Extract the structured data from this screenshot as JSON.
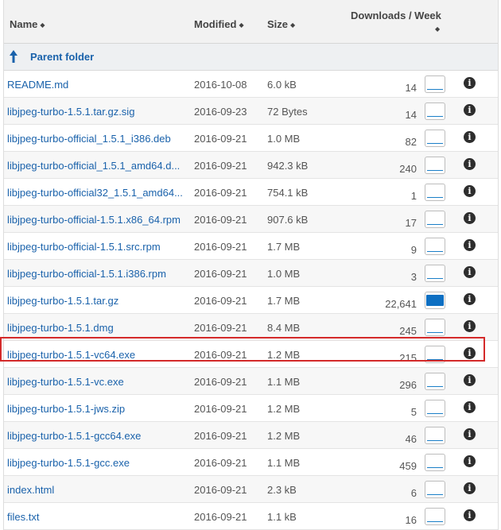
{
  "header": {
    "name": "Name",
    "modified": "Modified",
    "size": "Size",
    "downloads": "Downloads / Week",
    "sort_glyph": "◆"
  },
  "parent": {
    "label": "Parent folder"
  },
  "info_glyph": "i",
  "rows": [
    {
      "name": "README.md",
      "modified": "2016-10-08",
      "size": "6.0 kB",
      "downloads": "14"
    },
    {
      "name": "libjpeg-turbo-1.5.1.tar.gz.sig",
      "modified": "2016-09-23",
      "size": "72 Bytes",
      "downloads": "14"
    },
    {
      "name": "libjpeg-turbo-official_1.5.1_i386.deb",
      "modified": "2016-09-21",
      "size": "1.0 MB",
      "downloads": "82"
    },
    {
      "name": "libjpeg-turbo-official_1.5.1_amd64.d...",
      "modified": "2016-09-21",
      "size": "942.3 kB",
      "downloads": "240"
    },
    {
      "name": "libjpeg-turbo-official32_1.5.1_amd64...",
      "modified": "2016-09-21",
      "size": "754.1 kB",
      "downloads": "1"
    },
    {
      "name": "libjpeg-turbo-official-1.5.1.x86_64.rpm",
      "modified": "2016-09-21",
      "size": "907.6 kB",
      "downloads": "17"
    },
    {
      "name": "libjpeg-turbo-official-1.5.1.src.rpm",
      "modified": "2016-09-21",
      "size": "1.7 MB",
      "downloads": "9"
    },
    {
      "name": "libjpeg-turbo-official-1.5.1.i386.rpm",
      "modified": "2016-09-21",
      "size": "1.0 MB",
      "downloads": "3"
    },
    {
      "name": "libjpeg-turbo-1.5.1.tar.gz",
      "modified": "2016-09-21",
      "size": "1.7 MB",
      "downloads": "22,641"
    },
    {
      "name": "libjpeg-turbo-1.5.1.dmg",
      "modified": "2016-09-21",
      "size": "8.4 MB",
      "downloads": "245"
    },
    {
      "name": "libjpeg-turbo-1.5.1-vc64.exe",
      "modified": "2016-09-21",
      "size": "1.2 MB",
      "downloads": "215"
    },
    {
      "name": "libjpeg-turbo-1.5.1-vc.exe",
      "modified": "2016-09-21",
      "size": "1.1 MB",
      "downloads": "296"
    },
    {
      "name": "libjpeg-turbo-1.5.1-jws.zip",
      "modified": "2016-09-21",
      "size": "1.2 MB",
      "downloads": "5"
    },
    {
      "name": "libjpeg-turbo-1.5.1-gcc64.exe",
      "modified": "2016-09-21",
      "size": "1.2 MB",
      "downloads": "46"
    },
    {
      "name": "libjpeg-turbo-1.5.1-gcc.exe",
      "modified": "2016-09-21",
      "size": "1.1 MB",
      "downloads": "459"
    },
    {
      "name": "index.html",
      "modified": "2016-09-21",
      "size": "2.3 kB",
      "downloads": "6"
    },
    {
      "name": "files.txt",
      "modified": "2016-09-21",
      "size": "1.1 kB",
      "downloads": "16"
    }
  ],
  "colors": {
    "link": "#1a62ab",
    "highlight": "#d42a2a",
    "sparkline": "#0d6fc2"
  }
}
